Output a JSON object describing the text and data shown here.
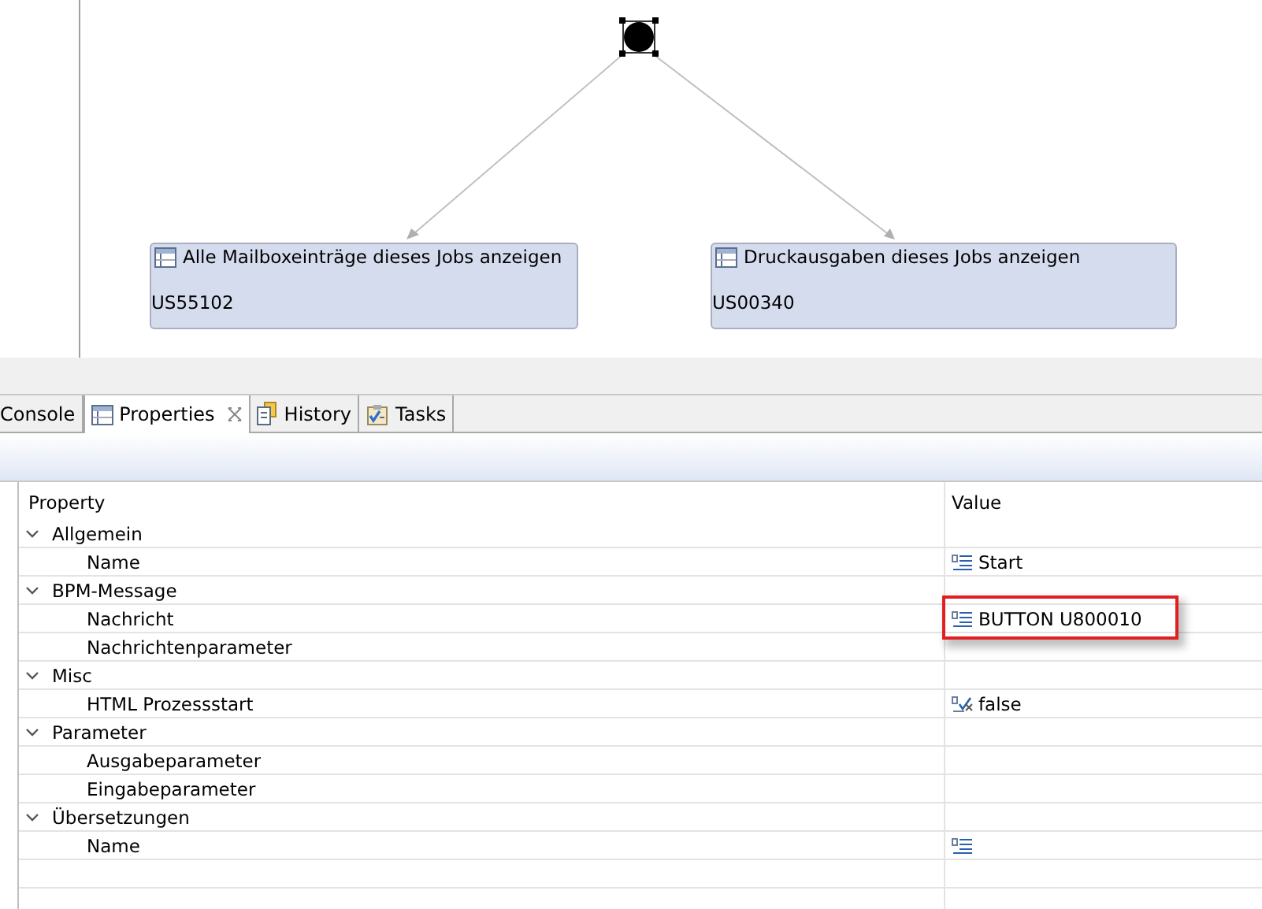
{
  "diagram": {
    "nodes": [
      {
        "title": "Alle Mailboxeinträge dieses Jobs anzeigen",
        "id": "US55102"
      },
      {
        "title": "Druckausgaben dieses Jobs anzeigen",
        "id": "US00340"
      }
    ]
  },
  "tabs": [
    {
      "label": "Console",
      "kind": "console",
      "selected": false
    },
    {
      "label": "Properties",
      "kind": "properties",
      "selected": true
    },
    {
      "label": "History",
      "kind": "history",
      "selected": false
    },
    {
      "label": "Tasks",
      "kind": "tasks",
      "selected": false
    }
  ],
  "table": {
    "columns": [
      "Property",
      "Value"
    ],
    "groups": [
      {
        "name": "Allgemein",
        "expanded": true,
        "children": [
          {
            "name": "Name",
            "value": {
              "kind": "text",
              "text": "Start"
            },
            "highlighted": false
          }
        ]
      },
      {
        "name": "BPM-Message",
        "expanded": true,
        "children": [
          {
            "name": "Nachricht",
            "value": {
              "kind": "text",
              "text": "BUTTON U800010"
            },
            "highlighted": true
          },
          {
            "name": "Nachrichtenparameter",
            "highlighted": false
          }
        ]
      },
      {
        "name": "Misc",
        "expanded": true,
        "children": [
          {
            "name": "HTML Prozessstart",
            "value": {
              "kind": "boolean",
              "text": "false"
            },
            "highlighted": false
          }
        ]
      },
      {
        "name": "Parameter",
        "expanded": true,
        "children": [
          {
            "name": "Ausgabeparameter",
            "highlighted": false
          },
          {
            "name": "Eingabeparameter",
            "highlighted": false
          }
        ]
      },
      {
        "name": "Übersetzungen",
        "expanded": true,
        "children": [
          {
            "name": "Name",
            "value": {
              "kind": "text"
            },
            "highlighted": false
          }
        ]
      }
    ]
  }
}
